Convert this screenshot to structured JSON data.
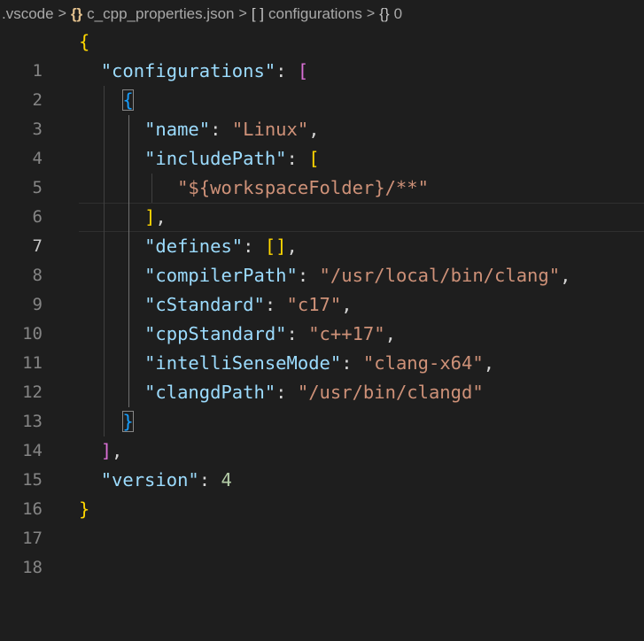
{
  "breadcrumb": {
    "folder": ".vscode",
    "file_icon": "{}",
    "file": "c_cpp_properties.json",
    "array_icon": "[ ]",
    "array": "configurations",
    "object_icon": "{}",
    "object": "0",
    "separator": ">"
  },
  "editor": {
    "current_line": 7,
    "line_numbers": [
      "1",
      "2",
      "3",
      "4",
      "5",
      "6",
      "7",
      "8",
      "9",
      "10",
      "11",
      "12",
      "13",
      "14",
      "15",
      "16",
      "17",
      "18"
    ],
    "tokens": {
      "colon": ": ",
      "comma": ",",
      "open_brace": "{",
      "close_brace": "}",
      "open_bracket": "[",
      "close_bracket": "]",
      "empty_array": "[]",
      "configurations_key": "\"configurations\"",
      "name_key": "\"name\"",
      "name_value": "\"Linux\"",
      "includePath_key": "\"includePath\"",
      "includePath_value": "\"${workspaceFolder}/**\"",
      "defines_key": "\"defines\"",
      "compilerPath_key": "\"compilerPath\"",
      "compilerPath_value": "\"/usr/local/bin/clang\"",
      "cStandard_key": "\"cStandard\"",
      "cStandard_value": "\"c17\"",
      "cppStandard_key": "\"cppStandard\"",
      "cppStandard_value": "\"c++17\"",
      "intelliSenseMode_key": "\"intelliSenseMode\"",
      "intelliSenseMode_value": "\"clang-x64\"",
      "clangdPath_key": "\"clangdPath\"",
      "clangdPath_value": "\"/usr/bin/clangd\"",
      "version_key": "\"version\"",
      "version_value": "4"
    }
  },
  "colors": {
    "background": "#1e1e1e",
    "key": "#9cdcfe",
    "string": "#ce9178",
    "number": "#b5cea8",
    "bracket_level1": "#ffd700",
    "bracket_level2": "#da70d6",
    "bracket_level3": "#179fff"
  }
}
